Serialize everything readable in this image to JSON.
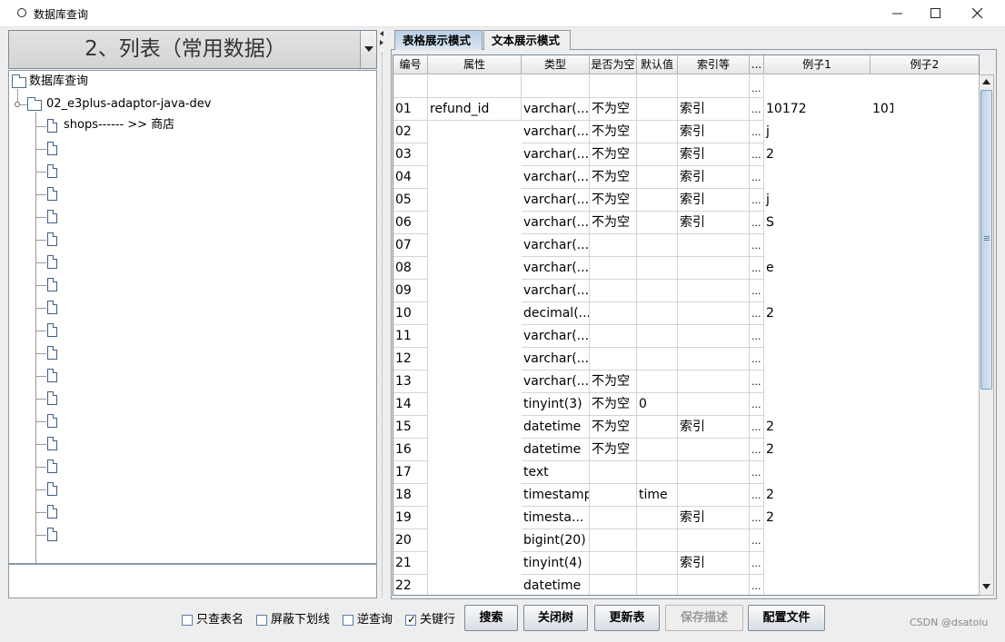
{
  "window": {
    "title": "数据库查询"
  },
  "combo": {
    "selected": "2、列表（常用数据）"
  },
  "tree": {
    "root": "数据库查询",
    "db": "02_e3plus-adaptor-java-dev",
    "first_table": "shops------ >> 商店",
    "unnamed_table_count": 18
  },
  "tabs": [
    "表格展示模式",
    "文本展示模式"
  ],
  "grid": {
    "headers": [
      "编号",
      "属性",
      "类型",
      "是否为空",
      "默认值",
      "索引等",
      "...",
      "例子1",
      "例子2"
    ],
    "rows": [
      [
        "01",
        "refund_id",
        "varchar(...",
        "不为空",
        "",
        "索引",
        "...",
        "10172",
        "101"
      ],
      [
        "02",
        "",
        "varchar(...",
        "不为空",
        "",
        "索引",
        "...",
        "j",
        ""
      ],
      [
        "03",
        "",
        "varchar(...",
        "不为空",
        "",
        "索引",
        "...",
        "2",
        ""
      ],
      [
        "04",
        "",
        "varchar(...",
        "不为空",
        "",
        "索引",
        "...",
        "",
        ""
      ],
      [
        "05",
        "",
        "varchar(...",
        "不为空",
        "",
        "索引",
        "...",
        "j",
        ""
      ],
      [
        "06",
        "",
        "varchar(...",
        "不为空",
        "",
        "索引",
        "...",
        "S",
        ""
      ],
      [
        "07",
        "",
        "varchar(...",
        "",
        "",
        "",
        "...",
        "",
        ""
      ],
      [
        "08",
        "",
        "varchar(...",
        "",
        "",
        "",
        "...",
        "e",
        ""
      ],
      [
        "09",
        "",
        "varchar(...",
        "",
        "",
        "",
        "...",
        "",
        ""
      ],
      [
        "10",
        "",
        "decimal(...",
        "",
        "",
        "",
        "...",
        "2",
        ""
      ],
      [
        "11",
        "",
        "varchar(...",
        "",
        "",
        "",
        "...",
        "",
        ""
      ],
      [
        "12",
        "",
        "varchar(...",
        "",
        "",
        "",
        "...",
        "",
        ""
      ],
      [
        "13",
        "",
        "varchar(...",
        "不为空",
        "",
        "",
        "...",
        "",
        ""
      ],
      [
        "14",
        "",
        "tinyint(3)",
        "不为空",
        "0",
        "",
        "...",
        "",
        ""
      ],
      [
        "15",
        "",
        "datetime",
        "不为空",
        "",
        "索引",
        "...",
        "2",
        ""
      ],
      [
        "16",
        "",
        "datetime",
        "不为空",
        "",
        "",
        "...",
        "2",
        ""
      ],
      [
        "17",
        "",
        "text",
        "",
        "",
        "",
        "...",
        "",
        ""
      ],
      [
        "18",
        "",
        "timestamp",
        "",
        "time",
        "",
        "...",
        "2",
        ""
      ],
      [
        "19",
        "",
        "timesta...",
        "",
        "",
        "索引",
        "...",
        "2",
        ""
      ],
      [
        "20",
        "",
        "bigint(20)",
        "",
        "",
        "",
        "...",
        "",
        ""
      ],
      [
        "21",
        "",
        "tinyint(4)",
        "",
        "",
        "索引",
        "...",
        "",
        ""
      ],
      [
        "22",
        "",
        "datetime",
        "",
        "",
        "",
        "...",
        "",
        ""
      ]
    ]
  },
  "toolbar": {
    "checkboxes": [
      {
        "label": "只查表名",
        "checked": false
      },
      {
        "label": "屏蔽下划线",
        "checked": false
      },
      {
        "label": "逆查询",
        "checked": false
      },
      {
        "label": "关键行",
        "checked": true
      }
    ],
    "buttons": [
      {
        "label": "搜索",
        "enabled": true
      },
      {
        "label": "关闭树",
        "enabled": true
      },
      {
        "label": "更新表",
        "enabled": true
      },
      {
        "label": "保存描述",
        "enabled": false
      },
      {
        "label": "配置文件",
        "enabled": true
      }
    ]
  },
  "watermark": "CSDN @dsatoiu"
}
